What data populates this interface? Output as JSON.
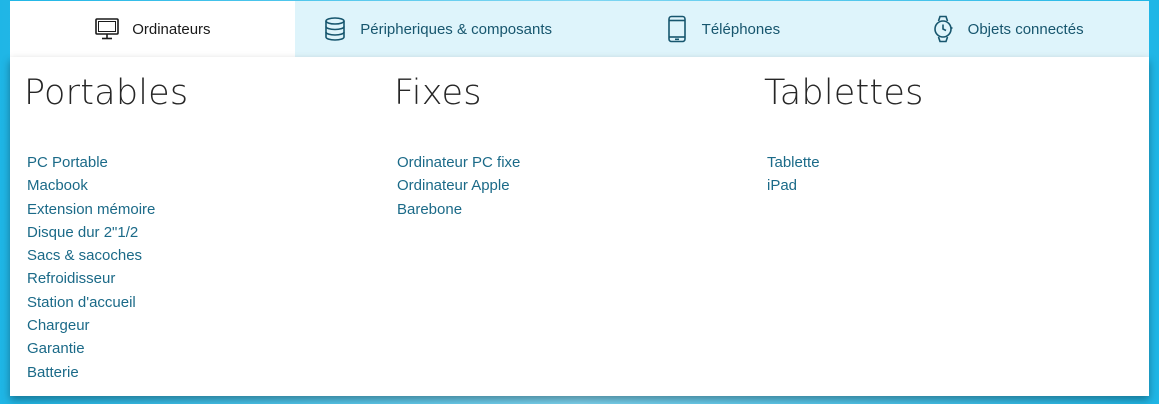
{
  "tabs": [
    {
      "label": "Ordinateurs",
      "icon": "monitor-icon",
      "active": true
    },
    {
      "label": "Péripheriques & composants",
      "icon": "database-stack-icon",
      "active": false
    },
    {
      "label": "Téléphones",
      "icon": "smartphone-icon",
      "active": false
    },
    {
      "label": "Objets connectés",
      "icon": "smartwatch-icon",
      "active": false
    }
  ],
  "columns": [
    {
      "title": "Portables",
      "links": [
        "PC Portable",
        "Macbook",
        "Extension mémoire",
        "Disque dur 2\"1/2",
        "Sacs & sacoches",
        "Refroidisseur",
        "Station d'accueil",
        "Chargeur",
        "Garantie",
        "Batterie"
      ]
    },
    {
      "title": "Fixes",
      "links": [
        "Ordinateur PC fixe",
        "Ordinateur Apple",
        "Barebone"
      ]
    },
    {
      "title": "Tablettes",
      "links": [
        "Tablette",
        "iPad"
      ]
    }
  ],
  "colors": {
    "page_background": "#1fb6e6",
    "tab_bar": "#def4fb",
    "active_tab": "#ffffff",
    "link": "#1b6a88",
    "heading": "#262626"
  }
}
